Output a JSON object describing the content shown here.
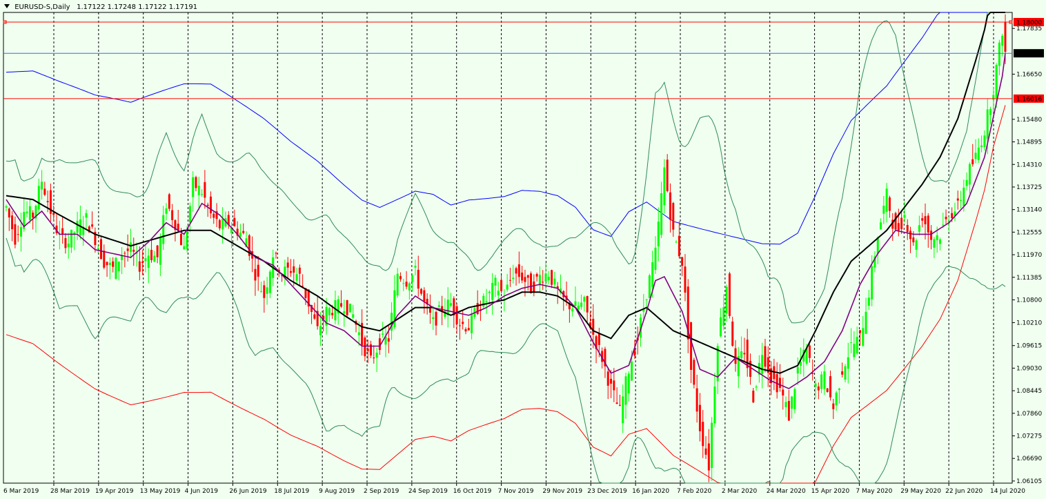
{
  "chart_data": {
    "type": "candlestick",
    "symbol_label": "EURUSD-S,Daily",
    "ohlc_readout": "1.17122 1.17248 1.17122 1.17191",
    "ylim": [
      1.0605,
      1.1825
    ],
    "y_ticks": [
      1.17835,
      1.1665,
      1.1548,
      1.14895,
      1.1431,
      1.13725,
      1.1314,
      1.12555,
      1.1197,
      1.11385,
      1.108,
      1.1021,
      1.09615,
      1.0903,
      1.08445,
      1.0786,
      1.07275,
      1.0669,
      1.06105
    ],
    "y_tick_labels": [
      "1.17835",
      "1.16650",
      "1.15480",
      "1.14895",
      "1.14310",
      "1.13725",
      "1.13140",
      "1.12555",
      "1.11970",
      "1.11385",
      "1.10800",
      "1.10210",
      "1.09615",
      "1.09030",
      "1.08445",
      "1.07860",
      "1.07275",
      "1.06690",
      "1.06105"
    ],
    "x_labels": [
      "6 Mar 2019",
      "28 Mar 2019",
      "19 Apr 2019",
      "13 May 2019",
      "4 Jun 2019",
      "26 Jun 2019",
      "18 Jul 2019",
      "9 Aug 2019",
      "2 Sep 2019",
      "24 Sep 2019",
      "16 Oct 2019",
      "7 Nov 2019",
      "29 Nov 2019",
      "23 Dec 2019",
      "16 Jan 2020",
      "7 Feb 2020",
      "2 Mar 2020",
      "24 Mar 2020",
      "15 Apr 2020",
      "7 May 2020",
      "29 May 2020",
      "22 Jun 2020",
      "14 Jul 2020"
    ],
    "horizontal_lines": [
      {
        "label": "1.18000",
        "value": 1.18,
        "color": "#ff0000"
      },
      {
        "label": "1.16016",
        "value": 1.16016,
        "color": "#ff0000"
      },
      {
        "label": "1.17191",
        "value": 1.17191,
        "color": "#4169e1"
      }
    ],
    "current_price_label": "1.17191",
    "colors": {
      "background": "#f0fff0",
      "bull": "#00ff00",
      "bear": "#ff0000",
      "ma_fast": "#800080",
      "ma_slow": "#000000",
      "bollinger": "#2e8b57",
      "envelope_upper": "#0000ff",
      "envelope_lower": "#ff0000"
    },
    "price_points": [
      [
        0,
        1.132
      ],
      [
        3,
        1.124
      ],
      [
        6,
        1.131
      ],
      [
        9,
        1.13
      ],
      [
        12,
        1.139
      ],
      [
        15,
        1.131
      ],
      [
        18,
        1.124
      ],
      [
        21,
        1.123
      ],
      [
        24,
        1.127
      ],
      [
        27,
        1.129
      ],
      [
        30,
        1.124
      ],
      [
        33,
        1.118
      ],
      [
        36,
        1.116
      ],
      [
        39,
        1.12
      ],
      [
        42,
        1.121
      ],
      [
        45,
        1.117
      ],
      [
        48,
        1.12
      ],
      [
        51,
        1.119
      ],
      [
        54,
        1.133
      ],
      [
        57,
        1.128
      ],
      [
        60,
        1.121
      ],
      [
        63,
        1.138
      ],
      [
        66,
        1.136
      ],
      [
        69,
        1.13
      ],
      [
        72,
        1.127
      ],
      [
        75,
        1.128
      ],
      [
        78,
        1.126
      ],
      [
        81,
        1.124
      ],
      [
        84,
        1.115
      ],
      [
        87,
        1.109
      ],
      [
        90,
        1.12
      ],
      [
        93,
        1.115
      ],
      [
        96,
        1.116
      ],
      [
        99,
        1.114
      ],
      [
        102,
        1.107
      ],
      [
        105,
        1.1
      ],
      [
        108,
        1.105
      ],
      [
        111,
        1.106
      ],
      [
        114,
        1.107
      ],
      [
        117,
        1.104
      ],
      [
        120,
        1.097
      ],
      [
        123,
        1.092
      ],
      [
        126,
        1.097
      ],
      [
        129,
        1.098
      ],
      [
        132,
        1.115
      ],
      [
        135,
        1.113
      ],
      [
        138,
        1.115
      ],
      [
        141,
        1.107
      ],
      [
        144,
        1.102
      ],
      [
        147,
        1.106
      ],
      [
        150,
        1.107
      ],
      [
        153,
        1.102
      ],
      [
        156,
        1.101
      ],
      [
        159,
        1.106
      ],
      [
        162,
        1.108
      ],
      [
        165,
        1.112
      ],
      [
        168,
        1.109
      ],
      [
        171,
        1.115
      ],
      [
        174,
        1.114
      ],
      [
        177,
        1.111
      ],
      [
        180,
        1.114
      ],
      [
        183,
        1.115
      ],
      [
        186,
        1.11
      ],
      [
        189,
        1.107
      ],
      [
        192,
        1.106
      ],
      [
        195,
        1.107
      ],
      [
        198,
        1.099
      ],
      [
        201,
        1.093
      ],
      [
        204,
        1.085
      ],
      [
        207,
        1.079
      ],
      [
        210,
        1.09
      ],
      [
        213,
        1.098
      ],
      [
        216,
        1.11
      ],
      [
        219,
        1.12
      ],
      [
        222,
        1.142
      ],
      [
        225,
        1.125
      ],
      [
        228,
        1.118
      ],
      [
        231,
        1.09
      ],
      [
        234,
        1.075
      ],
      [
        237,
        1.065
      ],
      [
        240,
        1.098
      ],
      [
        243,
        1.112
      ],
      [
        246,
        1.09
      ],
      [
        249,
        1.095
      ],
      [
        252,
        1.083
      ],
      [
        255,
        1.095
      ],
      [
        258,
        1.088
      ],
      [
        261,
        1.085
      ],
      [
        264,
        1.078
      ],
      [
        267,
        1.09
      ],
      [
        270,
        1.095
      ],
      [
        273,
        1.085
      ],
      [
        276,
        1.088
      ],
      [
        279,
        1.08
      ],
      [
        282,
        1.09
      ],
      [
        285,
        1.096
      ],
      [
        288,
        1.098
      ],
      [
        291,
        1.11
      ],
      [
        294,
        1.125
      ],
      [
        297,
        1.135
      ],
      [
        300,
        1.125
      ],
      [
        303,
        1.13
      ],
      [
        306,
        1.122
      ],
      [
        309,
        1.13
      ],
      [
        312,
        1.124
      ],
      [
        315,
        1.125
      ],
      [
        318,
        1.13
      ],
      [
        321,
        1.132
      ],
      [
        324,
        1.14
      ],
      [
        327,
        1.145
      ],
      [
        330,
        1.152
      ],
      [
        333,
        1.163
      ],
      [
        336,
        1.178
      ],
      [
        337,
        1.1719
      ]
    ],
    "ma_slow_points": [
      [
        0,
        1.135
      ],
      [
        9,
        1.134
      ],
      [
        18,
        1.13
      ],
      [
        30,
        1.125
      ],
      [
        42,
        1.122
      ],
      [
        51,
        1.124
      ],
      [
        60,
        1.126
      ],
      [
        69,
        1.126
      ],
      [
        78,
        1.122
      ],
      [
        87,
        1.118
      ],
      [
        96,
        1.113
      ],
      [
        105,
        1.109
      ],
      [
        114,
        1.104
      ],
      [
        120,
        1.101
      ],
      [
        126,
        1.1
      ],
      [
        132,
        1.103
      ],
      [
        138,
        1.106
      ],
      [
        144,
        1.106
      ],
      [
        150,
        1.104
      ],
      [
        156,
        1.106
      ],
      [
        162,
        1.107
      ],
      [
        168,
        1.108
      ],
      [
        174,
        1.11
      ],
      [
        180,
        1.11
      ],
      [
        186,
        1.109
      ],
      [
        192,
        1.106
      ],
      [
        198,
        1.1
      ],
      [
        204,
        1.098
      ],
      [
        210,
        1.104
      ],
      [
        216,
        1.106
      ],
      [
        219,
        1.104
      ],
      [
        225,
        1.1
      ],
      [
        231,
        1.098
      ],
      [
        237,
        1.096
      ],
      [
        243,
        1.094
      ],
      [
        249,
        1.092
      ],
      [
        255,
        1.09
      ],
      [
        261,
        1.089
      ],
      [
        267,
        1.091
      ],
      [
        273,
        1.1
      ],
      [
        279,
        1.11
      ],
      [
        285,
        1.118
      ],
      [
        291,
        1.122
      ],
      [
        297,
        1.126
      ],
      [
        303,
        1.132
      ],
      [
        309,
        1.138
      ],
      [
        315,
        1.145
      ],
      [
        321,
        1.155
      ],
      [
        327,
        1.17
      ],
      [
        330,
        1.178
      ],
      [
        333,
        1.189
      ],
      [
        337,
        1.1995
      ]
    ],
    "ma_fast_points": [
      [
        0,
        1.134
      ],
      [
        6,
        1.127
      ],
      [
        12,
        1.131
      ],
      [
        18,
        1.125
      ],
      [
        24,
        1.125
      ],
      [
        30,
        1.121
      ],
      [
        36,
        1.12
      ],
      [
        42,
        1.119
      ],
      [
        48,
        1.123
      ],
      [
        54,
        1.128
      ],
      [
        60,
        1.125
      ],
      [
        66,
        1.133
      ],
      [
        72,
        1.13
      ],
      [
        78,
        1.125
      ],
      [
        84,
        1.119
      ],
      [
        90,
        1.117
      ],
      [
        96,
        1.112
      ],
      [
        102,
        1.107
      ],
      [
        108,
        1.102
      ],
      [
        114,
        1.1
      ],
      [
        120,
        1.096
      ],
      [
        126,
        1.096
      ],
      [
        132,
        1.104
      ],
      [
        138,
        1.109
      ],
      [
        144,
        1.106
      ],
      [
        150,
        1.105
      ],
      [
        156,
        1.104
      ],
      [
        162,
        1.106
      ],
      [
        168,
        1.109
      ],
      [
        174,
        1.111
      ],
      [
        180,
        1.112
      ],
      [
        186,
        1.111
      ],
      [
        192,
        1.106
      ],
      [
        198,
        1.097
      ],
      [
        204,
        1.089
      ],
      [
        210,
        1.091
      ],
      [
        216,
        1.105
      ],
      [
        219,
        1.113
      ],
      [
        222,
        1.114
      ],
      [
        228,
        1.105
      ],
      [
        234,
        1.09
      ],
      [
        240,
        1.088
      ],
      [
        246,
        1.093
      ],
      [
        252,
        1.09
      ],
      [
        258,
        1.087
      ],
      [
        264,
        1.085
      ],
      [
        270,
        1.088
      ],
      [
        276,
        1.092
      ],
      [
        282,
        1.1
      ],
      [
        288,
        1.112
      ],
      [
        294,
        1.12
      ],
      [
        300,
        1.126
      ],
      [
        306,
        1.125
      ],
      [
        312,
        1.125
      ],
      [
        318,
        1.128
      ],
      [
        324,
        1.133
      ],
      [
        330,
        1.145
      ],
      [
        336,
        1.166
      ],
      [
        337,
        1.172
      ]
    ]
  }
}
